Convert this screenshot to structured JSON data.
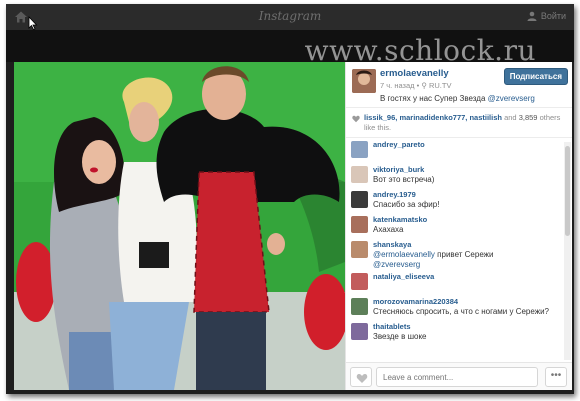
{
  "topbar": {
    "brand": "Instagram",
    "signin_label": "Войти"
  },
  "watermark": "www.schlock.ru",
  "post": {
    "username": "ermolaevanelly",
    "time": "7 ч. назад",
    "location": "RU.TV",
    "follow_label": "Подписаться",
    "caption_text": "В гостях у нас Супер Звезда ",
    "caption_mention": "@zverevserg",
    "caption_emoji": "",
    "likes_names": "lissik_96, marinadidenko777, nastiilish",
    "likes_and": "and",
    "likes_count": "3,859",
    "likes_others": "others like this."
  },
  "comments": [
    {
      "user": "andrey_pareto",
      "mention": "",
      "text": "",
      "avatar_color": "#8aa2c2"
    },
    {
      "user": "viktoriya_burk",
      "mention": "",
      "text": "Вот это встреча)",
      "avatar_color": "#d9c6b8"
    },
    {
      "user": "andrey.1979",
      "mention": "",
      "text": "Спасибо за эфир!",
      "avatar_color": "#3b3b3b"
    },
    {
      "user": "katenkamatsko",
      "mention": "",
      "text": "Ахахаха",
      "avatar_color": "#a86f5c"
    },
    {
      "user": "shanskaya",
      "mention": "@ermolaevanelly",
      "text": " привет Сережи ",
      "mention2": "@zverevserg",
      "avatar_color": "#b98b6c"
    },
    {
      "user": "nataliya_eliseeva",
      "mention": "",
      "text": "",
      "avatar_color": "#c25c5c"
    },
    {
      "user": "morozovamarina220384",
      "mention": "",
      "text": "Стесняюсь спросить, а что с ногами у Сережи?",
      "avatar_color": "#5d7f59"
    },
    {
      "user": "thaitablets",
      "mention": "",
      "text": "Звезде в шоке",
      "avatar_color": "#7e6a9c"
    }
  ],
  "footer": {
    "comment_placeholder": "Leave a comment...",
    "more_label": "•••"
  },
  "colors": {
    "link": "#285d8f",
    "follow_button": "#3f729b",
    "green_screen": "#2fa33a"
  }
}
